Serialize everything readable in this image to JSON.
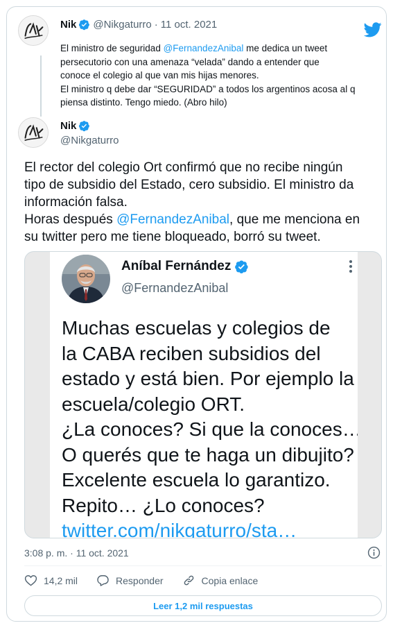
{
  "quoted_tweet": {
    "author_name": "Nik",
    "author_handle": "@Nikgaturro",
    "separator": "·",
    "date": "11 oct. 2021",
    "text_lines": [
      {
        "before": "El ministro de seguridad ",
        "mention": "@FernandezAnibal",
        "after": " me dedica un tweet"
      },
      {
        "text": "persecutorio con una amenaza “velada” dando a entender que"
      },
      {
        "text": "conoce el colegio al que van mis hijas menores."
      },
      {
        "text": "El ministro q debe dar “SEGURIDAD” a todos los argentinos acosa al q"
      },
      {
        "text": "piensa distinto. Tengo miedo. (Abro hilo)"
      }
    ]
  },
  "main_tweet": {
    "author_name": "Nik",
    "author_handle": "@Nikgaturro",
    "text_lines": [
      {
        "text": "El rector del colegio Ort confirmó que no recibe ningún"
      },
      {
        "text": "tipo de subsidio del Estado, cero subsidio. El ministro da"
      },
      {
        "text": "información falsa."
      },
      {
        "before": "Horas después ",
        "mention": "@FernandezAnibal",
        "after": ", que me menciona en"
      },
      {
        "text": "su twitter pero me tiene bloqueado, borró su tweet."
      }
    ],
    "timestamp": "3:08 p. m. · 11 oct. 2021"
  },
  "embedded_screenshot": {
    "author_name": "Aníbal Fernández",
    "author_handle": "@FernandezAnibal",
    "text_lines": [
      "Muchas escuelas y colegios de",
      "la CABA reciben subsidios del",
      "estado y está bien. Por ejemplo la",
      "escuela/colegio ORT.",
      "¿La conoces? Si que la conoces…",
      "O querés que te haga un dibujito?",
      "Excelente escuela lo garantizo.",
      "Repito… ¿Lo conoces?"
    ],
    "link_text": "twitter.com/nikgaturro/sta…"
  },
  "actions": {
    "likes": "14,2 mil",
    "reply_label": "Responder",
    "copy_label": "Copia enlace"
  },
  "replies_button": "Leer 1,2 mil respuestas",
  "colors": {
    "accent": "#1d9bf0",
    "text": "#0f1419",
    "secondary": "#536471",
    "border": "#cfd9de"
  },
  "icons": [
    "twitter-bird-icon",
    "verified-badge-icon",
    "more-options-icon",
    "info-icon",
    "heart-icon",
    "reply-bubble-icon",
    "link-icon"
  ]
}
